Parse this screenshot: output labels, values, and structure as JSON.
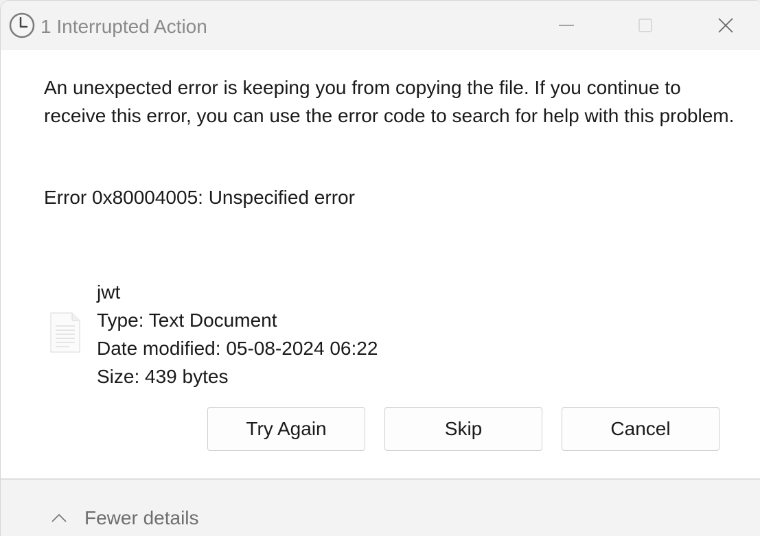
{
  "window": {
    "title": "1 Interrupted Action",
    "title_icon": "clock-icon"
  },
  "titlebar_controls": {
    "minimize_icon": "minimize-icon",
    "maximize_icon": "maximize-icon",
    "close_icon": "close-icon"
  },
  "dialog": {
    "message": "An unexpected error is keeping you from copying the file. If you continue to receive this error, you can use the error code to search for help with this problem.",
    "error_code": "Error 0x80004005: Unspecified error"
  },
  "file": {
    "icon": "text-document-icon",
    "name": "jwt",
    "type": "Type: Text Document",
    "date_modified": "Date modified: 05-08-2024 06:22",
    "size": "Size: 439 bytes"
  },
  "buttons": {
    "try_again": "Try Again",
    "skip": "Skip",
    "cancel": "Cancel"
  },
  "footer": {
    "details_label": "Fewer details",
    "chevron_icon": "chevron-up-icon"
  },
  "colors": {
    "titlebar_bg": "#f3f3f3",
    "content_bg": "#ffffff",
    "title_text": "#8a8a8a",
    "body_text": "#1a1a1a",
    "button_border": "#cfcfcf"
  }
}
